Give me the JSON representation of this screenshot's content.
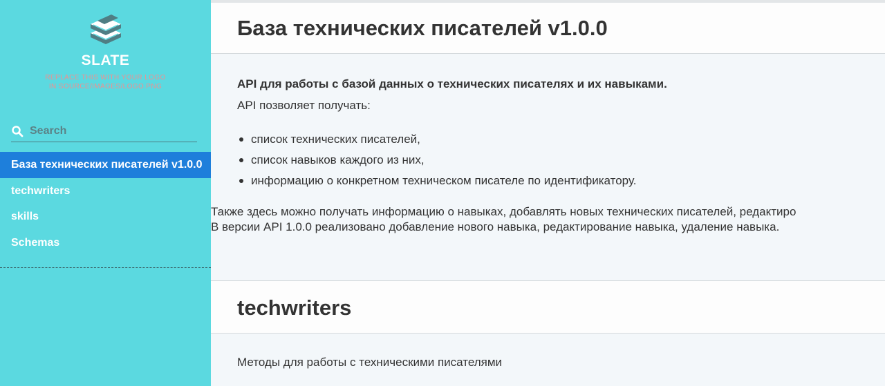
{
  "sidebar": {
    "logo_text": "SLATE",
    "logo_note_line1": "REPLACE THIS WITH YOUR LOGO",
    "logo_note_line2": "IN SOURCE/IMAGES/LOGO.PNG",
    "search_placeholder": "Search",
    "toc": [
      {
        "label": "База технических писателей v1.0.0",
        "active": true
      },
      {
        "label": "techwriters",
        "active": false
      },
      {
        "label": "skills",
        "active": false
      },
      {
        "label": "Schemas",
        "active": false
      }
    ],
    "colors": {
      "background": "#5bd9e0",
      "active_item": "#1e7fdb",
      "logo_note": "#f08f8f"
    }
  },
  "main": {
    "section1": {
      "title": "База технических писателей v1.0.0",
      "intro_bold": "API для работы с базой данных о технических писателях и их навыками.",
      "intro_text": "API позволяет получать:",
      "list": [
        "список технических писателей,",
        "список навыков каждого из них,",
        "информацию о конкретном техническом писателе по идентификатору."
      ],
      "paragraph1": "Также здесь можно получать информацию о навыках, добавлять новых технических писателей, редактиро",
      "paragraph2": "В версии API 1.0.0 реализовано добавление нового навыка, редактирование навыка, удаление навыка."
    },
    "section2": {
      "title": "techwriters",
      "text": "Методы для работы с техническими писателями"
    }
  }
}
